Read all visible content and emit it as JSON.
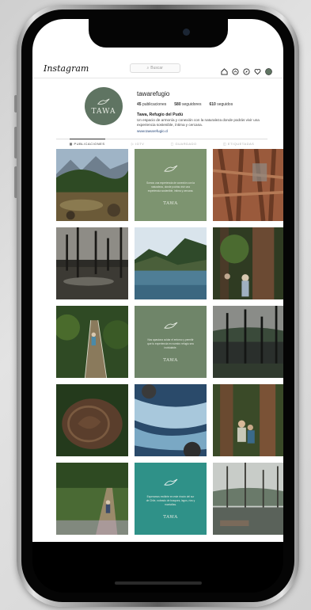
{
  "app": {
    "logo_text": "Instagram",
    "search_placeholder": "Buscar",
    "nav_icons": [
      "home-icon",
      "messenger-icon",
      "explore-icon",
      "heart-icon",
      "profile-avatar"
    ]
  },
  "profile": {
    "username": "tawarefugio",
    "avatar_brand": "TAWA",
    "stats": [
      {
        "value": "45",
        "label": "publicaciones"
      },
      {
        "value": "580",
        "label": "seguidores"
      },
      {
        "value": "610",
        "label": "seguidos"
      }
    ],
    "bio_name": "Tawa, Refugio del Pudú",
    "bio_text": "Un espacio de armonía y conexión con la naturaleza donde podrás vivir una experiencia sostenible, íntima y cercana.",
    "bio_link": "www.tawarefugio.cl"
  },
  "tabs": [
    "PUBLICACIONES",
    "IGTV",
    "GUARDADO",
    "ETIQUETADAS"
  ],
  "brand_tiles": [
    {
      "message": "Somos una experiencia de conexión con la naturaleza, donde podrás vivir una experiencia sostenible, íntima y cercana.",
      "brand": "TAWA",
      "color": "#7d9470"
    },
    {
      "message": "Nos apasiona cuidar el entorno y permitir que tu experiencia en nuestro refugio sea inolvidable.",
      "brand": "TAWA",
      "color": "#6f8569"
    },
    {
      "message": "Esperamos recibirte en este rincón del sur de Chile, rodeado de bosques, lagos, ríos y montañas.",
      "brand": "TAWA",
      "color": "#2f9188"
    }
  ],
  "colors": {
    "accent_green": "#5f7462",
    "teal": "#2f9188",
    "background": "#ffffff"
  }
}
